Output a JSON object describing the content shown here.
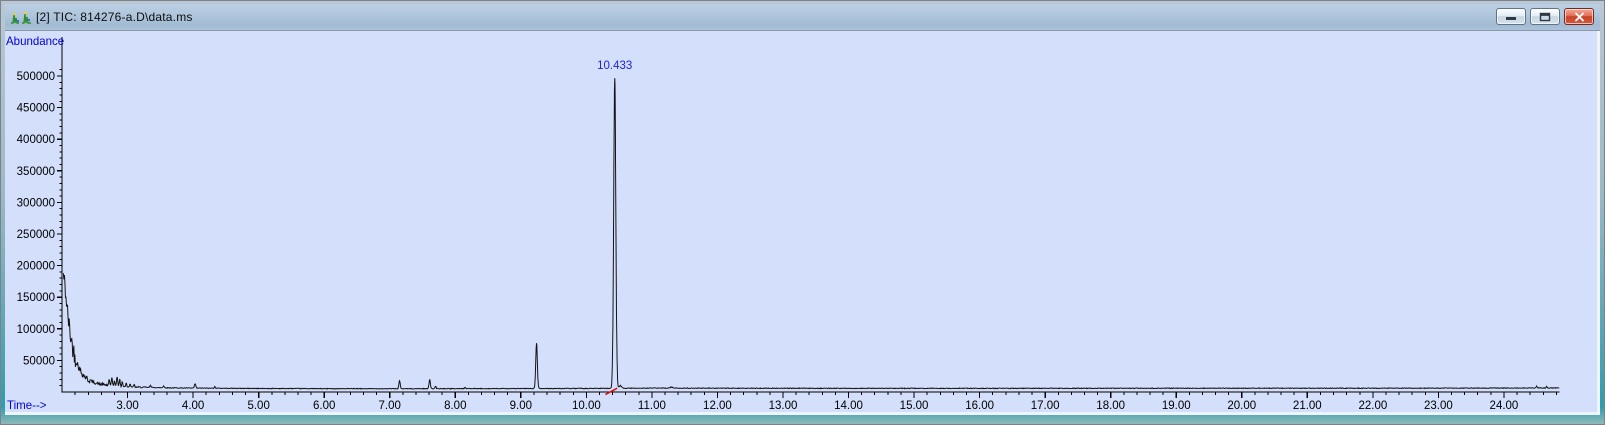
{
  "window": {
    "title": "[2] TIC: 814276-a.D\\data.ms",
    "controls": {
      "minimize": "minimize-icon",
      "restore": "restore-icon",
      "close": "close-icon"
    }
  },
  "colors": {
    "plot_bg": "#d4e0fb",
    "trace": "#141414",
    "axis_label_blue": "#0000dd",
    "peak_label_blue": "#2222dd",
    "integration_red": "#dd1111",
    "frame_teal": "#2f9dad"
  },
  "chart_data": {
    "type": "line",
    "title": "[2] TIC: 814276-a.D\\data.ms",
    "xlabel": "Time-->",
    "ylabel": "Abundance",
    "x_range": [
      2.0,
      24.85
    ],
    "y_range": [
      0,
      515000
    ],
    "grid": false,
    "legend": "none",
    "x_tick_labels": [
      "3.00",
      "4.00",
      "5.00",
      "6.00",
      "7.00",
      "8.00",
      "9.00",
      "10.00",
      "11.00",
      "12.00",
      "13.00",
      "14.00",
      "15.00",
      "16.00",
      "17.00",
      "18.00",
      "19.00",
      "20.00",
      "21.00",
      "22.00",
      "23.00",
      "24.00"
    ],
    "x_minor_tick_step": 0.2,
    "y_tick_labels": [
      "50000",
      "100000",
      "150000",
      "200000",
      "250000",
      "300000",
      "350000",
      "400000",
      "450000",
      "500000"
    ],
    "y_minor_tick_step": 10000,
    "annotated_peaks": [
      {
        "time": 10.433,
        "apex_abundance": 497000,
        "label": "10.433"
      }
    ],
    "peaks": [
      [
        2.72,
        9000,
        0.008
      ],
      [
        2.76,
        12000,
        0.008
      ],
      [
        2.8,
        8000,
        0.007
      ],
      [
        2.84,
        15000,
        0.008
      ],
      [
        2.88,
        11000,
        0.008
      ],
      [
        2.92,
        7500,
        0.007
      ],
      [
        2.98,
        6000,
        0.007
      ],
      [
        3.04,
        5000,
        0.007
      ],
      [
        3.1,
        4000,
        0.007
      ],
      [
        3.35,
        3000,
        0.01
      ],
      [
        3.55,
        2500,
        0.01
      ],
      [
        4.03,
        6500,
        0.01
      ],
      [
        4.33,
        2500,
        0.008
      ],
      [
        7.15,
        12500,
        0.01
      ],
      [
        7.61,
        15000,
        0.01
      ],
      [
        7.7,
        4000,
        0.008
      ],
      [
        8.15,
        2000,
        0.008
      ],
      [
        9.24,
        72000,
        0.012
      ],
      [
        10.433,
        491000,
        0.016
      ],
      [
        10.52,
        4000,
        0.02
      ],
      [
        11.3,
        1500,
        0.02
      ],
      [
        24.5,
        2500,
        0.01
      ],
      [
        24.65,
        2000,
        0.008
      ]
    ],
    "baseline_points": [
      [
        2.02,
        185000
      ],
      [
        2.04,
        172000
      ],
      [
        2.06,
        150000
      ],
      [
        2.09,
        120000
      ],
      [
        2.12,
        95000
      ],
      [
        2.16,
        72000
      ],
      [
        2.2,
        55000
      ],
      [
        2.25,
        40000
      ],
      [
        2.3,
        30000
      ],
      [
        2.4,
        19000
      ],
      [
        2.5,
        14500
      ],
      [
        2.6,
        12000
      ],
      [
        2.8,
        9500
      ],
      [
        3.0,
        8200
      ],
      [
        3.3,
        7200
      ],
      [
        3.6,
        6600
      ],
      [
        4.0,
        6200
      ],
      [
        5.0,
        5600
      ],
      [
        6.0,
        5300
      ],
      [
        7.0,
        5200
      ],
      [
        8.0,
        5300
      ],
      [
        9.0,
        5400
      ],
      [
        10.0,
        5600
      ],
      [
        11.0,
        6200
      ],
      [
        12.0,
        6000
      ],
      [
        14.0,
        5800
      ],
      [
        16.0,
        5800
      ],
      [
        18.0,
        5900
      ],
      [
        20.0,
        6000
      ],
      [
        22.0,
        6000
      ],
      [
        24.0,
        6200
      ],
      [
        24.85,
        6400
      ]
    ],
    "noise_zones": [
      [
        2.22,
        15000
      ],
      [
        2.45,
        5000
      ],
      [
        2.7,
        2200
      ],
      [
        3.3,
        1100
      ],
      [
        24.9,
        520
      ]
    ],
    "integration_mark": {
      "t1": 10.29,
      "v1": -4000,
      "t2": 10.47,
      "v2": 6000
    }
  }
}
